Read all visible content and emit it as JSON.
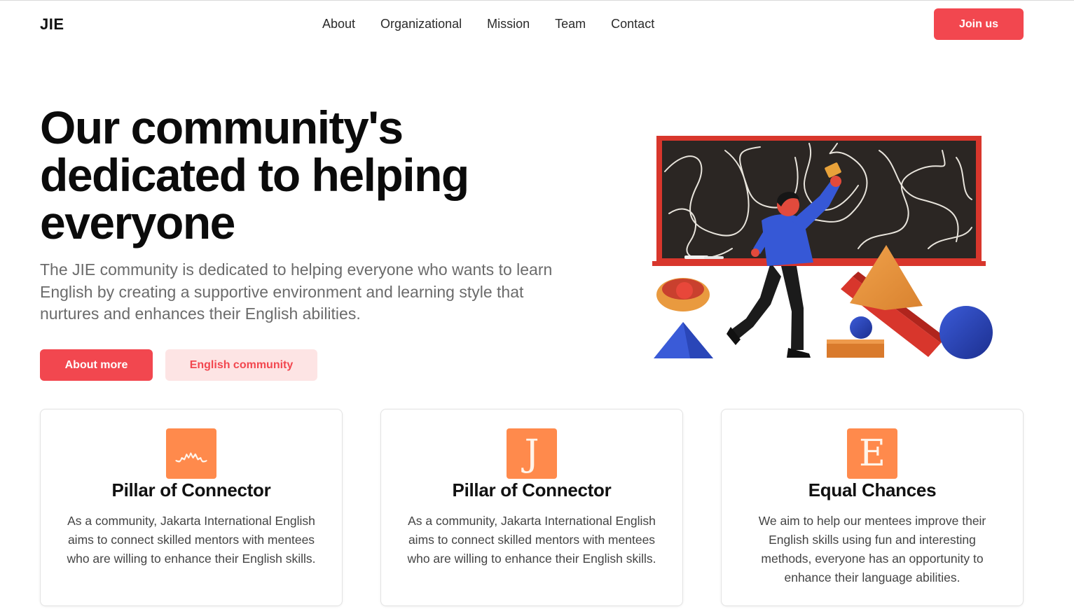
{
  "nav": {
    "logo": "JIE",
    "links": [
      "About",
      "Organizational",
      "Mission",
      "Team",
      "Contact"
    ],
    "cta_label": "Join us"
  },
  "hero": {
    "title": "Our community's dedicated to helping everyone",
    "description": "The JIE community is dedicated to helping everyone who wants to learn English by creating a supportive environment and learning style that nurtures and enhances their English abilities.",
    "primary_button": "About more",
    "secondary_button": "English community"
  },
  "cards": [
    {
      "icon_glyph": "෴",
      "icon_name": "ornament-icon",
      "title": "Pillar of Connector",
      "text": "As a community, Jakarta International English aims to connect skilled mentors with mentees who are willing to enhance their English skills."
    },
    {
      "icon_glyph": "J",
      "icon_name": "letter-j-icon",
      "title": "Pillar of Connector",
      "text": "As a community, Jakarta International English aims to connect skilled mentors with mentees who are willing to enhance their English skills."
    },
    {
      "icon_glyph": "E",
      "icon_name": "letter-e-icon",
      "title": "Equal Chances",
      "text": "We aim to help our mentees improve their English skills using fun and interesting methods, everyone has an opportunity to enhance their language abilities."
    }
  ],
  "colors": {
    "accent": "#f2474f",
    "accent_soft": "#fde4e4",
    "icon_bg": "#ff8a4c"
  }
}
